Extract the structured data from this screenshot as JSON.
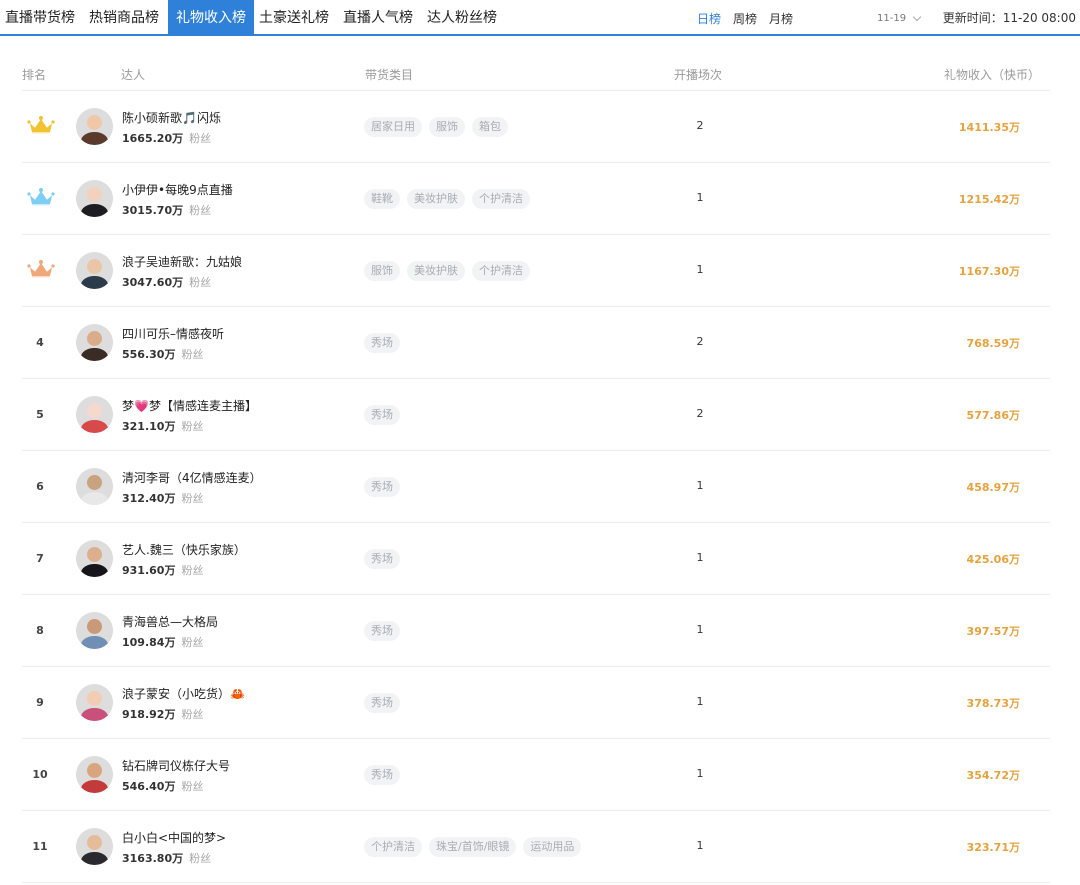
{
  "tabs": [
    {
      "label": "直播带货榜",
      "active": false
    },
    {
      "label": "热销商品榜",
      "active": false
    },
    {
      "label": "礼物收入榜",
      "active": true
    },
    {
      "label": "土豪送礼榜",
      "active": false
    },
    {
      "label": "直播人气榜",
      "active": false
    },
    {
      "label": "达人粉丝榜",
      "active": false
    }
  ],
  "periods": [
    {
      "label": "日榜",
      "active": true
    },
    {
      "label": "周榜",
      "active": false
    },
    {
      "label": "月榜",
      "active": false
    }
  ],
  "date_select": {
    "value": "11-19"
  },
  "update_time": "更新时间：11-20 08:00",
  "columns": {
    "rank": "排名",
    "streamer": "达人",
    "categories": "带货类目",
    "sessions": "开播场次",
    "income": "礼物收入（快币）"
  },
  "fans_label": "粉丝",
  "colors": {
    "accent": "#2f80d8",
    "income": "#e6a23c",
    "gold_crown": "#f2c230",
    "silver_crown": "#7ecdf2",
    "bronze_crown": "#f0a878"
  },
  "rows": [
    {
      "rank": "1",
      "crown": "gold-crown-icon",
      "name": "陈小硕新歌🎵闪烁",
      "fans": "1665.20万",
      "categories": [
        "居家日用",
        "服饰",
        "箱包"
      ],
      "sessions": "2",
      "income": "1411.35万",
      "avatar_face": "#f0c8a8",
      "avatar_body": "#5a3a2a"
    },
    {
      "rank": "2",
      "crown": "silver-crown-icon",
      "name": "小伊伊•每晚9点直播",
      "fans": "3015.70万",
      "categories": [
        "鞋靴",
        "美妆护肤",
        "个护清洁"
      ],
      "sessions": "1",
      "income": "1215.42万",
      "avatar_face": "#f3d2bd",
      "avatar_body": "#1e1e22"
    },
    {
      "rank": "3",
      "crown": "bronze-crown-icon",
      "name": "浪子吴迪新歌：九姑娘",
      "fans": "3047.60万",
      "categories": [
        "服饰",
        "美妆护肤",
        "个护清洁"
      ],
      "sessions": "1",
      "income": "1167.30万",
      "avatar_face": "#e9c6a8",
      "avatar_body": "#2b3b4a"
    },
    {
      "rank": "4",
      "crown": "",
      "name": "四川可乐–情感夜听",
      "fans": "556.30万",
      "categories": [
        "秀场"
      ],
      "sessions": "2",
      "income": "768.59万",
      "avatar_face": "#d9ad8c",
      "avatar_body": "#3a2c24"
    },
    {
      "rank": "5",
      "crown": "",
      "name": "梦💗梦【情感连麦主播】",
      "fans": "321.10万",
      "categories": [
        "秀场"
      ],
      "sessions": "2",
      "income": "577.86万",
      "avatar_face": "#f5d9cf",
      "avatar_body": "#d84a4a"
    },
    {
      "rank": "6",
      "crown": "",
      "name": "清河李哥（4亿情感连麦）",
      "fans": "312.40万",
      "categories": [
        "秀场"
      ],
      "sessions": "1",
      "income": "458.97万",
      "avatar_face": "#c9a27f",
      "avatar_body": "#e8e8e8"
    },
    {
      "rank": "7",
      "crown": "",
      "name": "艺人.魏三（快乐家族）",
      "fans": "931.60万",
      "categories": [
        "秀场"
      ],
      "sessions": "1",
      "income": "425.06万",
      "avatar_face": "#dcb08e",
      "avatar_body": "#15151a"
    },
    {
      "rank": "8",
      "crown": "",
      "name": "青海兽总—大格局",
      "fans": "109.84万",
      "categories": [
        "秀场"
      ],
      "sessions": "1",
      "income": "397.57万",
      "avatar_face": "#c99a7a",
      "avatar_body": "#6f8fb5"
    },
    {
      "rank": "9",
      "crown": "",
      "name": "浪子蒙安（小吃货）🦀",
      "fans": "918.92万",
      "categories": [
        "秀场"
      ],
      "sessions": "1",
      "income": "378.73万",
      "avatar_face": "#f2cdb4",
      "avatar_body": "#c9507a"
    },
    {
      "rank": "10",
      "crown": "",
      "name": "钻石牌司仪栋仔大号",
      "fans": "546.40万",
      "categories": [
        "秀场"
      ],
      "sessions": "1",
      "income": "354.72万",
      "avatar_face": "#d8a57f",
      "avatar_body": "#c23a3a"
    },
    {
      "rank": "11",
      "crown": "",
      "name": "白小白<中国的梦>",
      "fans": "3163.80万",
      "categories": [
        "个护清洁",
        "珠宝/首饰/眼镜",
        "运动用品"
      ],
      "sessions": "1",
      "income": "323.71万",
      "avatar_face": "#e5bb9a",
      "avatar_body": "#2a2a2e"
    }
  ]
}
